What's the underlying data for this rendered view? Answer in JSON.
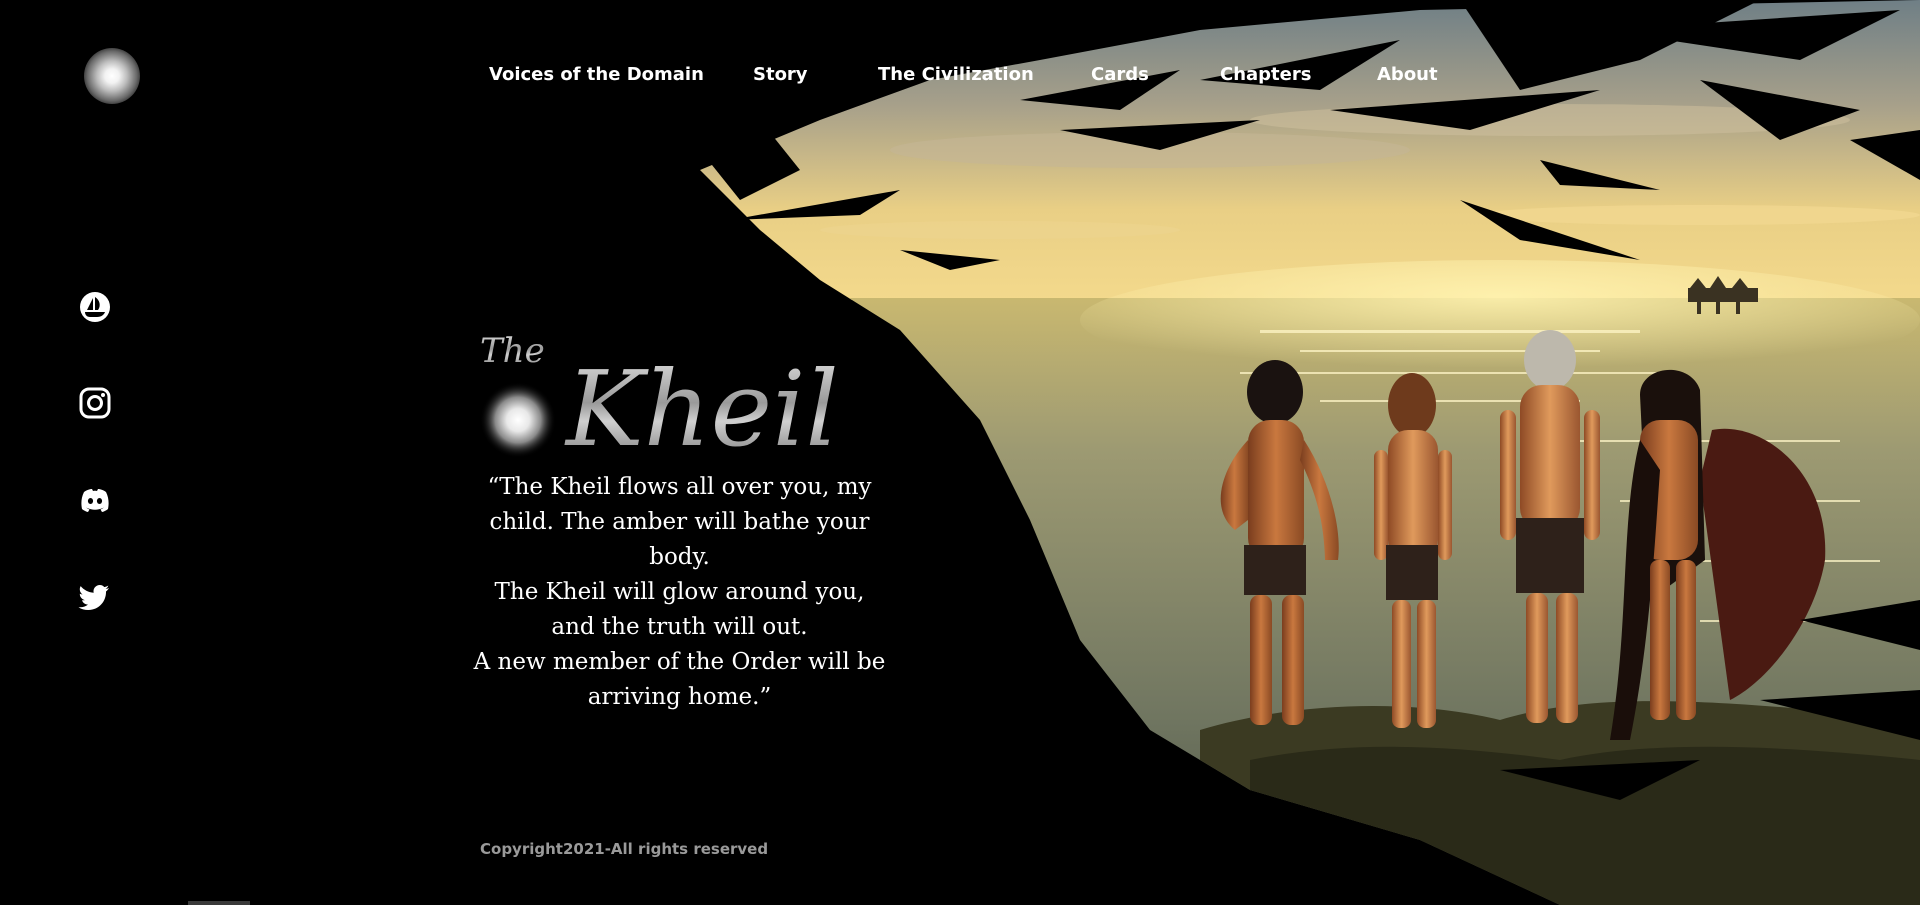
{
  "site": {
    "logo_icon": "orb-logo-icon"
  },
  "nav": {
    "items": [
      {
        "label": "Voices of the Domain"
      },
      {
        "label": "Story"
      },
      {
        "label": "The Civilization"
      },
      {
        "label": "Cards"
      },
      {
        "label": "Chapters"
      },
      {
        "label": "About"
      }
    ]
  },
  "social": {
    "items": [
      {
        "icon": "opensea-icon"
      },
      {
        "icon": "instagram-icon"
      },
      {
        "icon": "discord-icon"
      },
      {
        "icon": "twitter-icon"
      }
    ]
  },
  "hero": {
    "title_prefix": "The",
    "title": "Kheil",
    "quote_lines": [
      "“The Kheil flows all over you, my",
      "child. The amber will bathe your",
      "body.",
      "The Kheil will glow around you,",
      "and the truth will out.",
      "A new member of the Order will be",
      "arriving home.”"
    ]
  },
  "footer": {
    "copyright": "Copyright2021-All rights reserved"
  },
  "colors": {
    "background": "#000000",
    "text": "#ffffff",
    "muted": "#9a9a9a",
    "sky_gold": "#e9c46a",
    "sea": "#8a8f70"
  }
}
